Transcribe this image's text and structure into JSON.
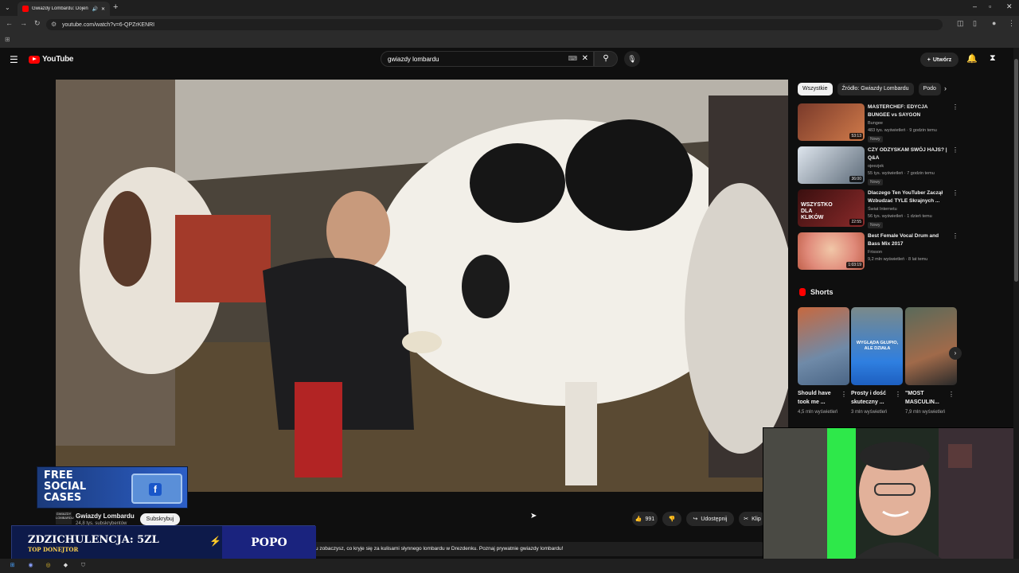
{
  "browser": {
    "tab_title": "Gwiazdy Lombardu: Dojenie",
    "url": "youtube.com/watch?v=6-QPZrKENRI",
    "new_tab": "+"
  },
  "youtube": {
    "logo_text": "YouTube",
    "search_value": "gwiazdy lombardu",
    "create_label": "Utwórz"
  },
  "chips": [
    "Wszystkie",
    "Źródło: Gwiazdy Lombardu",
    "Podo"
  ],
  "recommendations": [
    {
      "title": "MASTERCHEF: EDYCJA BUNGEE vs SAYGON",
      "channel": "Bungee",
      "meta": "483 tys. wyświetleń · 9 godzin temu",
      "badge": "Nowy",
      "duration": "53:13"
    },
    {
      "title": "CZY ODZYSKAM SWÓJ HAJS? | Q&A",
      "channel": "ojeezjek",
      "meta": "55 tys. wyświetleń · 7 godzin temu",
      "badge": "Nowy",
      "duration": "36:00"
    },
    {
      "title": "Dlaczego Ten YouTuber Zaczął Wzbudzać TYLE Skrajnych ...",
      "channel": "Świat Internetu",
      "meta": "56 tys. wyświetleń · 1 dzień temu",
      "badge": "Nowy",
      "duration": "22:55",
      "thumb_text": "WSZYSTKO DLA KLIKÓW"
    },
    {
      "title": "Best Female Vocal Drum and Bass Mix 2017",
      "channel": "Frisson",
      "meta": "9,2 mln wyświetleń · 8 lat temu",
      "badge": "",
      "duration": "1:03:19"
    }
  ],
  "shorts": {
    "heading": "Shorts",
    "items": [
      {
        "title": "Should have took me ...",
        "views": "4,5 mln wyświetleń"
      },
      {
        "title": "Prosty i dość skuteczny ...",
        "views": "3 mln wyświetleń",
        "thumb_text": "WYGLĄDA GŁUPIO, ALE DZIAŁA"
      },
      {
        "title": "\"MOST MASCULIN...",
        "views": "7,9 mln wyświetleń"
      }
    ]
  },
  "ad": {
    "line1": "FREE",
    "line2": "SOCIAL",
    "line3": "CASES"
  },
  "channel": {
    "logo_text": "GWIAZDY LOMBARDU",
    "name": "Gwiazdy Lombardu",
    "subs": "24,8 tys. subskrybentów",
    "subscribe": "Subskrybuj"
  },
  "actions": {
    "likes": "991",
    "share": "Udostępnij",
    "clip": "Klip"
  },
  "description": "u zobaczysz, co kryje się za kulisami słynnego lombardu w Drezdenku. Poznaj prywatnie gwiazdy lombardu!",
  "donation": {
    "line": "ZDZICHULENCJA: 5ZL",
    "sub": "TOP DONEJTOR",
    "name": "POPO"
  },
  "colors": {
    "brand_red": "#ff0000",
    "bg": "#0f0f0f",
    "chip": "#272727",
    "donate_bg": "#0d1a4a"
  }
}
